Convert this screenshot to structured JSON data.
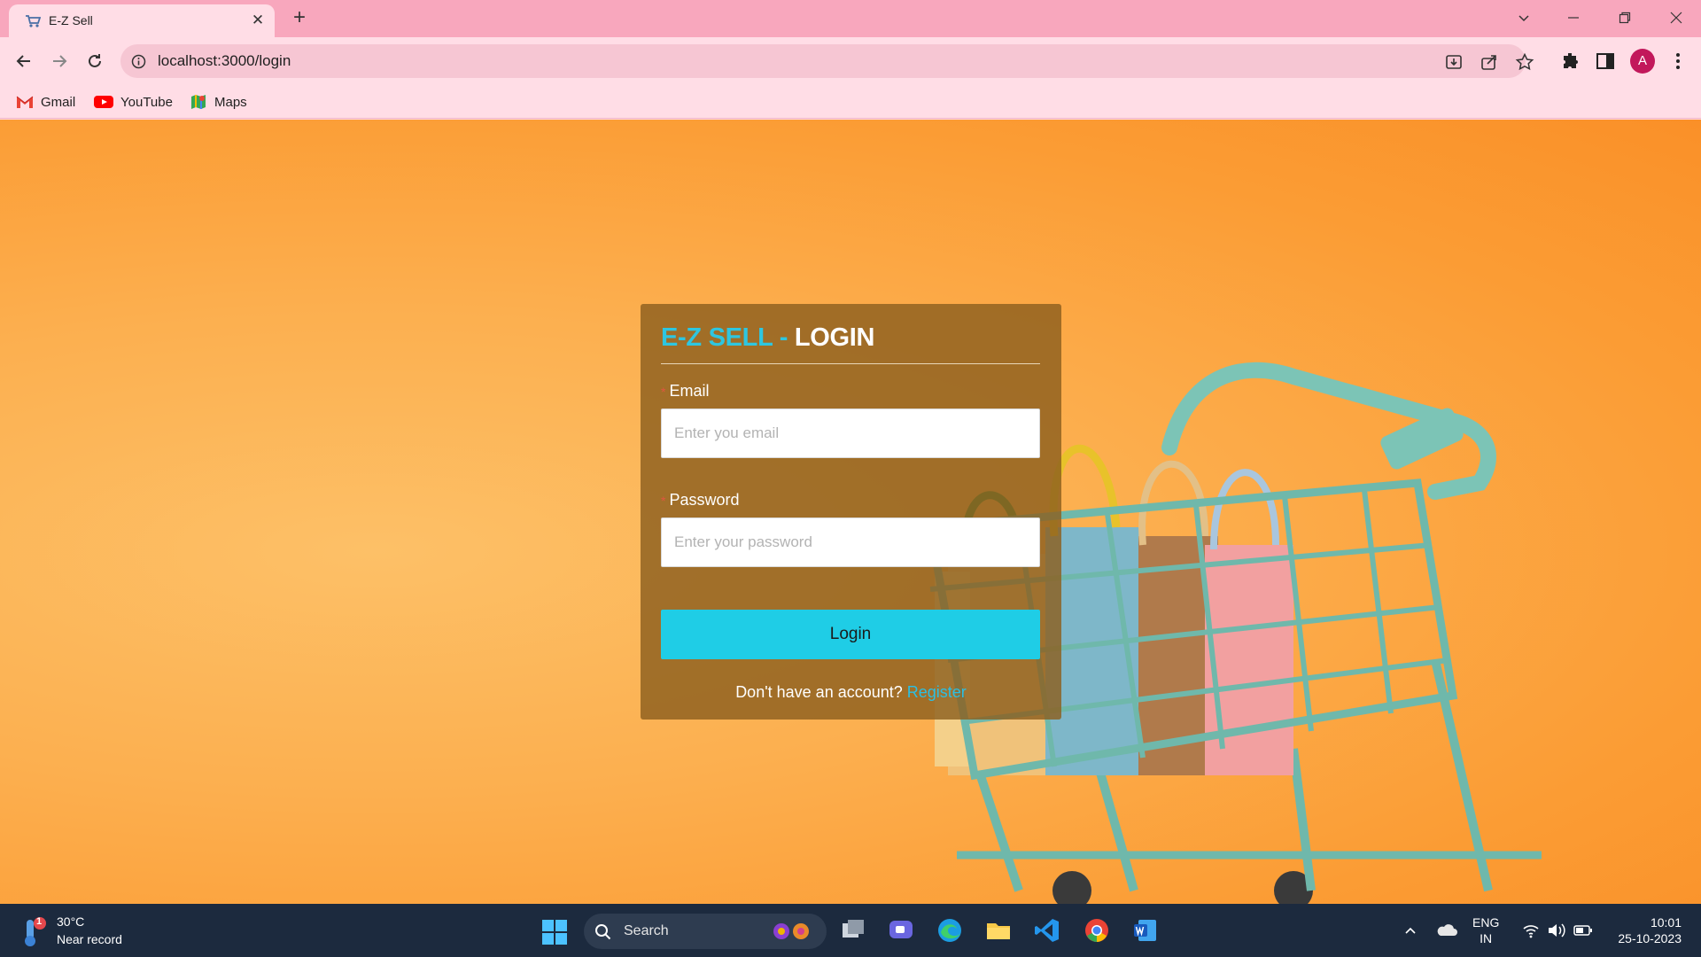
{
  "browser": {
    "tab_title": "E-Z Sell",
    "url": "localhost:3000/login",
    "profile_initial": "A",
    "bookmarks": [
      {
        "label": "Gmail",
        "icon": "gmail-icon"
      },
      {
        "label": "YouTube",
        "icon": "youtube-icon"
      },
      {
        "label": "Maps",
        "icon": "maps-icon"
      }
    ]
  },
  "login": {
    "title_brand": "E-Z SELL - ",
    "title_main": "LOGIN",
    "email_label": "Email",
    "email_placeholder": "Enter you email",
    "password_label": "Password",
    "password_placeholder": "Enter your password",
    "button_label": "Login",
    "register_prompt": "Don't have an account? ",
    "register_link": "Register"
  },
  "taskbar": {
    "weather_temp": "30°C",
    "weather_desc": "Near record",
    "weather_badge": "1",
    "search_label": "Search",
    "lang_line1": "ENG",
    "lang_line2": "IN",
    "time": "10:01",
    "date": "25-10-2023"
  },
  "colors": {
    "accent": "#1fcde6",
    "brand_title": "#2ec6e0",
    "page_background": "#fb9c34",
    "card_background": "#8c5f1e"
  }
}
